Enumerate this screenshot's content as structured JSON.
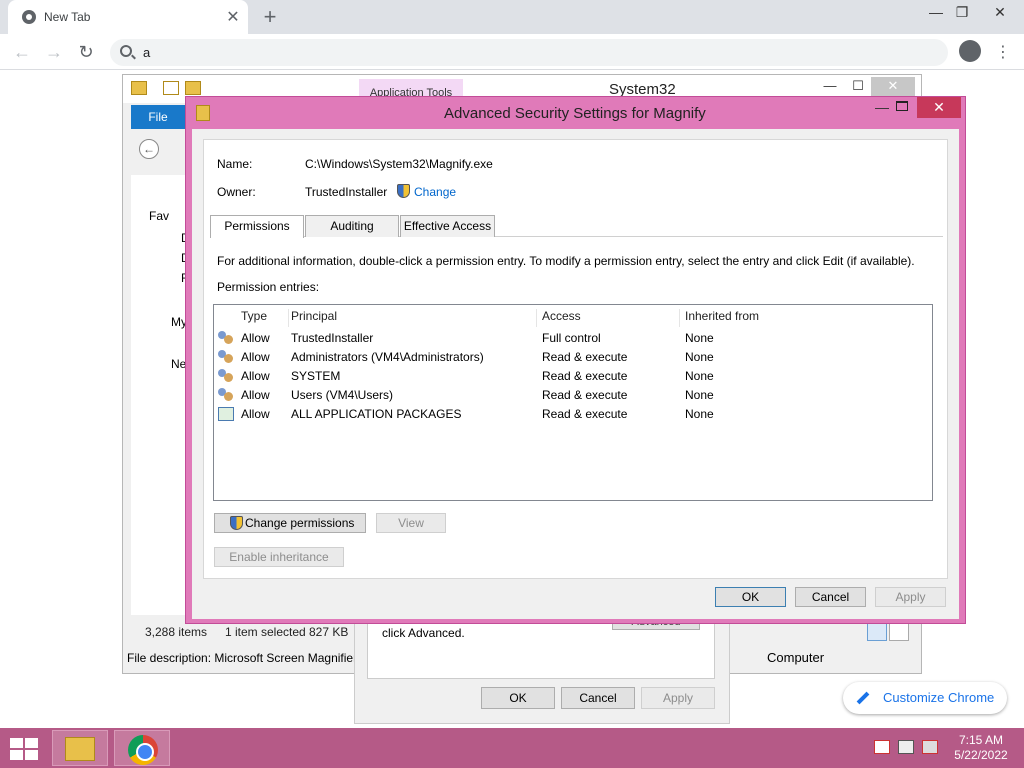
{
  "browser": {
    "tab_title": "New Tab",
    "tab_close": "✕",
    "new_tab": "+",
    "minimize": "—",
    "restore": "❐",
    "close": "✕",
    "back": "←",
    "forward": "→",
    "reload": "↻",
    "address_value": "a",
    "menu": "⋮",
    "customize_label": "Customize Chrome"
  },
  "explorer": {
    "title": "System32",
    "ribbon_context_tab": "Application Tools",
    "file_tab": "File",
    "minimize": "—",
    "maximize": "☐",
    "close": "✕",
    "tree": {
      "favorites": "Fav",
      "item1": "D",
      "item2": "D",
      "item3": "R",
      "mypc": "My",
      "network": "Ne"
    },
    "status": {
      "items": "3,288 items",
      "selected": "1 item selected",
      "size": "827 KB",
      "description": "File description: Microsoft Screen Magnifier",
      "computer": "Computer"
    }
  },
  "properties": {
    "text": "click Advanced.",
    "advanced_button": "Advanced",
    "ok": "OK",
    "cancel": "Cancel",
    "apply": "Apply"
  },
  "dialog": {
    "title": "Advanced Security Settings for Magnify",
    "close": "✕",
    "minimize": "—",
    "name_label": "Name:",
    "name_value": "C:\\Windows\\System32\\Magnify.exe",
    "owner_label": "Owner:",
    "owner_value": "TrustedInstaller",
    "change_link": "Change",
    "tabs": [
      "Permissions",
      "Auditing",
      "Effective Access"
    ],
    "info_text": "For additional information, double-click a permission entry. To modify a permission entry, select the entry and click Edit (if available).",
    "entries_label": "Permission entries:",
    "columns": [
      "Type",
      "Principal",
      "Access",
      "Inherited from"
    ],
    "rows": [
      {
        "icon": "users-icon",
        "type": "Allow",
        "principal": "TrustedInstaller",
        "access": "Full control",
        "inherited": "None"
      },
      {
        "icon": "users-icon",
        "type": "Allow",
        "principal": "Administrators (VM4\\Administrators)",
        "access": "Read & execute",
        "inherited": "None"
      },
      {
        "icon": "users-icon",
        "type": "Allow",
        "principal": "SYSTEM",
        "access": "Read & execute",
        "inherited": "None"
      },
      {
        "icon": "users-icon",
        "type": "Allow",
        "principal": "Users (VM4\\Users)",
        "access": "Read & execute",
        "inherited": "None"
      },
      {
        "icon": "package-icon",
        "type": "Allow",
        "principal": "ALL APPLICATION PACKAGES",
        "access": "Read & execute",
        "inherited": "None"
      }
    ],
    "change_permissions": "Change permissions",
    "view": "View",
    "enable_inheritance": "Enable inheritance",
    "ok": "OK",
    "cancel": "Cancel",
    "apply": "Apply"
  },
  "taskbar": {
    "time": "7:15 AM",
    "date": "5/22/2022"
  },
  "colors": {
    "dialog_frame": "#e07ab9",
    "taskbar": "#b55a87",
    "link": "#0066cc",
    "chrome_accent": "#1a73e8"
  }
}
